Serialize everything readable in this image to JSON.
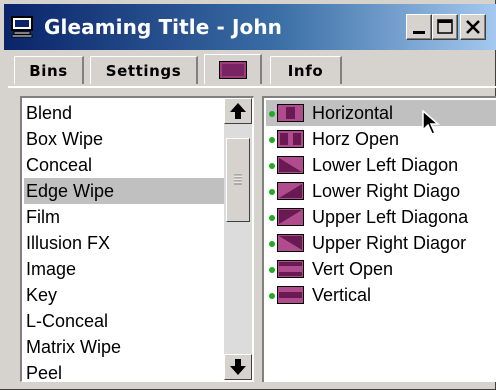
{
  "window": {
    "title": "Gleaming Title - John"
  },
  "titlebar_buttons": {
    "minimize": "minimize",
    "maximize": "maximize",
    "close": "close"
  },
  "tabs": [
    {
      "label": "Bins"
    },
    {
      "label": "Settings"
    },
    {
      "label": "",
      "icon": "effect-swatch-icon"
    },
    {
      "label": "Info"
    }
  ],
  "categories": {
    "selected": "Edge Wipe",
    "items": [
      "Blend",
      "Box Wipe",
      "Conceal",
      "Edge Wipe",
      "Film",
      "Illusion FX",
      "Image",
      "Key",
      "L-Conceal",
      "Matrix Wipe",
      "Peel"
    ]
  },
  "effects": {
    "selected": "Horizontal",
    "items": [
      "Horizontal",
      "Horz Open",
      "Lower Left Diagon",
      "Lower Right Diago",
      "Upper Left Diagona",
      "Upper Right Diagor",
      "Vert Open",
      "Vertical"
    ]
  },
  "colors": {
    "title_gradient_start": "#0a246a",
    "title_gradient_end": "#a6caf0",
    "effect_icon": "#8b2a6e",
    "selection": "#c0c0c0",
    "status_dot": "#22aa22"
  }
}
